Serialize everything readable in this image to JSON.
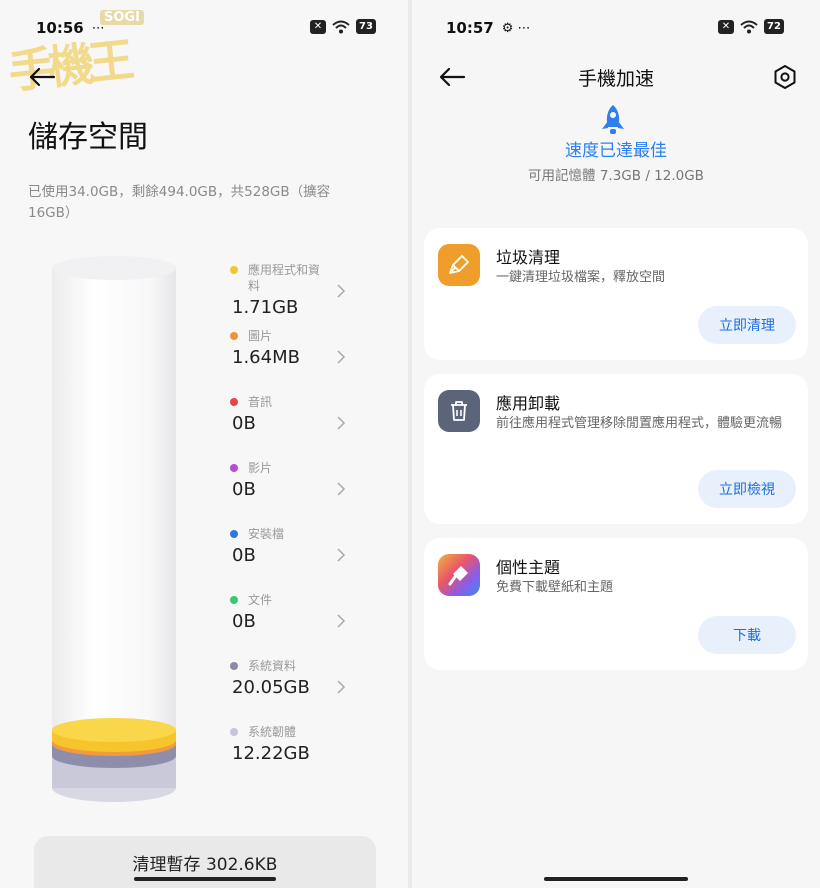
{
  "left": {
    "status": {
      "time": "10:56",
      "extra": "⋯",
      "battery": "73"
    },
    "watermark": {
      "logo": "SOGI",
      "text": "手機王"
    },
    "title": "儲存空間",
    "summary": "已使用34.0GB，剩餘494.0GB，共528GB（擴容16GB）",
    "items": [
      {
        "label": "應用程式和資料",
        "value": "1.71GB",
        "color": "#f2c531"
      },
      {
        "label": "圖片",
        "value": "1.64MB",
        "color": "#f2913a"
      },
      {
        "label": "音訊",
        "value": "0B",
        "color": "#e94345"
      },
      {
        "label": "影片",
        "value": "0B",
        "color": "#b24fd6"
      },
      {
        "label": "安裝檔",
        "value": "0B",
        "color": "#2f77dc"
      },
      {
        "label": "文件",
        "value": "0B",
        "color": "#36c779"
      },
      {
        "label": "系統資料",
        "value": "20.05GB",
        "color": "#8b8ba6"
      },
      {
        "label": "系統韌體",
        "value": "12.22GB",
        "color": "#c6c6d8"
      }
    ],
    "clean_button": "清理暫存 302.6KB"
  },
  "right": {
    "status": {
      "time": "10:57",
      "extra": "⚙ ⋯",
      "battery": "72"
    },
    "title": "手機加速",
    "speed_status": "速度已達最佳",
    "memory": "可用記憶體 7.3GB / 12.0GB",
    "cards": [
      {
        "title": "垃圾清理",
        "desc": "一鍵清理垃圾檔案，釋放空間",
        "button": "立即清理",
        "icon": "broom-icon",
        "color": "#ef9d2b"
      },
      {
        "title": "應用卸載",
        "desc": "前往應用程式管理移除閒置應用程式，體驗更流暢",
        "button": "立即檢視",
        "icon": "trash-icon",
        "color": "#5b6478"
      },
      {
        "title": "個性主題",
        "desc": "免費下載壁紙和主題",
        "button": "下載",
        "icon": "theme-brush-icon",
        "color": "#e45c6a"
      }
    ]
  }
}
